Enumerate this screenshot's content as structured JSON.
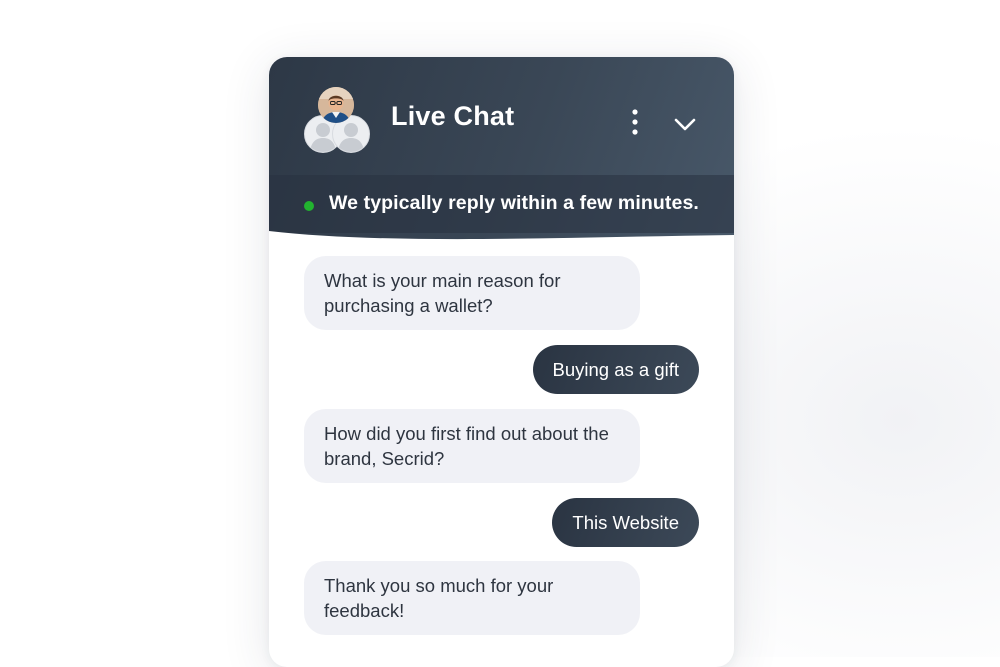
{
  "header": {
    "title": "Live Chat",
    "menu_icon": "vertical-dots-icon",
    "collapse_icon": "chevron-down-icon"
  },
  "status": {
    "text": "We typically reply within a few minutes.",
    "online_color": "#22b32f"
  },
  "messages": [
    {
      "sender": "bot",
      "text": "What is your main reason for purchasing a wallet?"
    },
    {
      "sender": "user",
      "text": "Buying as a gift"
    },
    {
      "sender": "bot",
      "text": "How did you first find out about the brand, Secrid?"
    },
    {
      "sender": "user",
      "text": "This Website"
    },
    {
      "sender": "bot",
      "text": "Thank you so much for your feedback!"
    }
  ],
  "colors": {
    "header_dark": "#2d3846",
    "user_bubble": "#2a3442",
    "bot_bubble": "#f0f1f6"
  }
}
